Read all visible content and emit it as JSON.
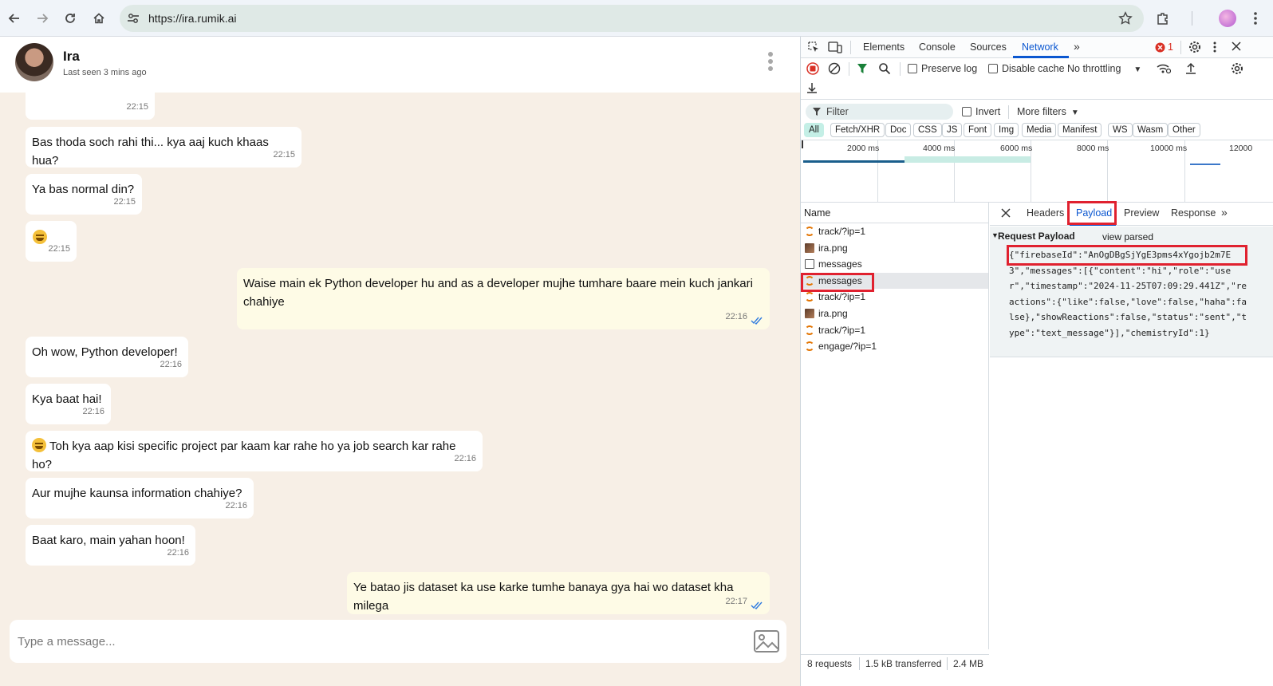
{
  "browser": {
    "url": "https://ira.rumik.ai",
    "icons": [
      "back-icon",
      "forward-icon",
      "reload-icon",
      "home-icon",
      "site-settings-icon",
      "bookmark-star-icon",
      "extensions-icon",
      "profile-avatar",
      "more-vert-icon"
    ]
  },
  "chat": {
    "contact_name": "Ira",
    "last_seen": "Last seen 3 mins ago",
    "messages": [
      {
        "dir": "in",
        "text": "",
        "time": "22:15"
      },
      {
        "dir": "in",
        "text": "Bas thoda soch rahi thi... kya aaj kuch khaas hua?",
        "time": "22:15"
      },
      {
        "dir": "in",
        "text": "Ya bas normal din?",
        "time": "22:15"
      },
      {
        "dir": "in",
        "text": "",
        "emoji": "grinning-face",
        "time": "22:15"
      },
      {
        "dir": "out",
        "text": "Waise main ek Python developer hu and as a developer mujhe tumhare baare mein kuch jankari chahiye",
        "time": "22:16"
      },
      {
        "dir": "in",
        "text": "Oh wow, Python developer!",
        "time": "22:16"
      },
      {
        "dir": "in",
        "text": "Kya baat hai!",
        "time": "22:16"
      },
      {
        "dir": "in",
        "text": "Toh kya aap kisi specific project par kaam kar rahe ho ya job search kar rahe ho?",
        "emoji": "grinning-face",
        "time": "22:16"
      },
      {
        "dir": "in",
        "text": "Aur mujhe kaunsa information chahiye?",
        "time": "22:16"
      },
      {
        "dir": "in",
        "text": "Baat karo, main yahan hoon!",
        "time": "22:16"
      },
      {
        "dir": "out",
        "text": "Ye batao jis dataset ka use karke tumhe banaya gya hai wo dataset kha milega",
        "time": "22:17"
      }
    ],
    "composer_placeholder": "Type a message..."
  },
  "devtools": {
    "tabs": [
      "Elements",
      "Console",
      "Sources",
      "Network"
    ],
    "active_tab": "Network",
    "error_count": "1",
    "toolbar": {
      "preserve_log": "Preserve log",
      "disable_cache": "Disable cache",
      "throttling": "No throttling"
    },
    "filter": {
      "placeholder": "Filter",
      "invert": "Invert",
      "more_filters": "More filters"
    },
    "types": [
      "All",
      "Fetch/XHR",
      "Doc",
      "CSS",
      "JS",
      "Font",
      "Img",
      "Media",
      "Manifest",
      "WS",
      "Wasm",
      "Other"
    ],
    "timeline_labels": [
      "2000 ms",
      "4000 ms",
      "6000 ms",
      "8000 ms",
      "10000 ms",
      "12000"
    ],
    "name_header": "Name",
    "requests": [
      {
        "name": "track/?ip=1",
        "kind": "xhr"
      },
      {
        "name": "ira.png",
        "kind": "img"
      },
      {
        "name": "messages",
        "kind": "doc"
      },
      {
        "name": "messages",
        "kind": "xhr",
        "selected": true
      },
      {
        "name": "track/?ip=1",
        "kind": "xhr"
      },
      {
        "name": "ira.png",
        "kind": "img"
      },
      {
        "name": "track/?ip=1",
        "kind": "xhr"
      },
      {
        "name": "engage/?ip=1",
        "kind": "xhr"
      }
    ],
    "detail_tabs": [
      "Headers",
      "Payload",
      "Preview",
      "Response"
    ],
    "active_detail_tab": "Payload",
    "payload_title": "Request Payload",
    "view_parsed": "view parsed",
    "payload_json": "{\"firebaseId\":\"AnOgDBgSjYgE3pms4xYgojb2m7E3\",\"messages\":[{\"content\":\"hi\",\"role\":\"user\",\"timestamp\":\"2024-11-25T07:09:29.441Z\",\"reactions\":{\"like\":false,\"love\":false,\"haha\":false},\"showReactions\":false,\"status\":\"sent\",\"type\":\"text_message\"}],\"chemistryId\":1}",
    "status": {
      "requests": "8 requests",
      "transferred": "1.5 kB transferred",
      "resources": "2.4 MB"
    },
    "highlight_color": "#e0212f",
    "accent_color": "#0b57d0"
  }
}
